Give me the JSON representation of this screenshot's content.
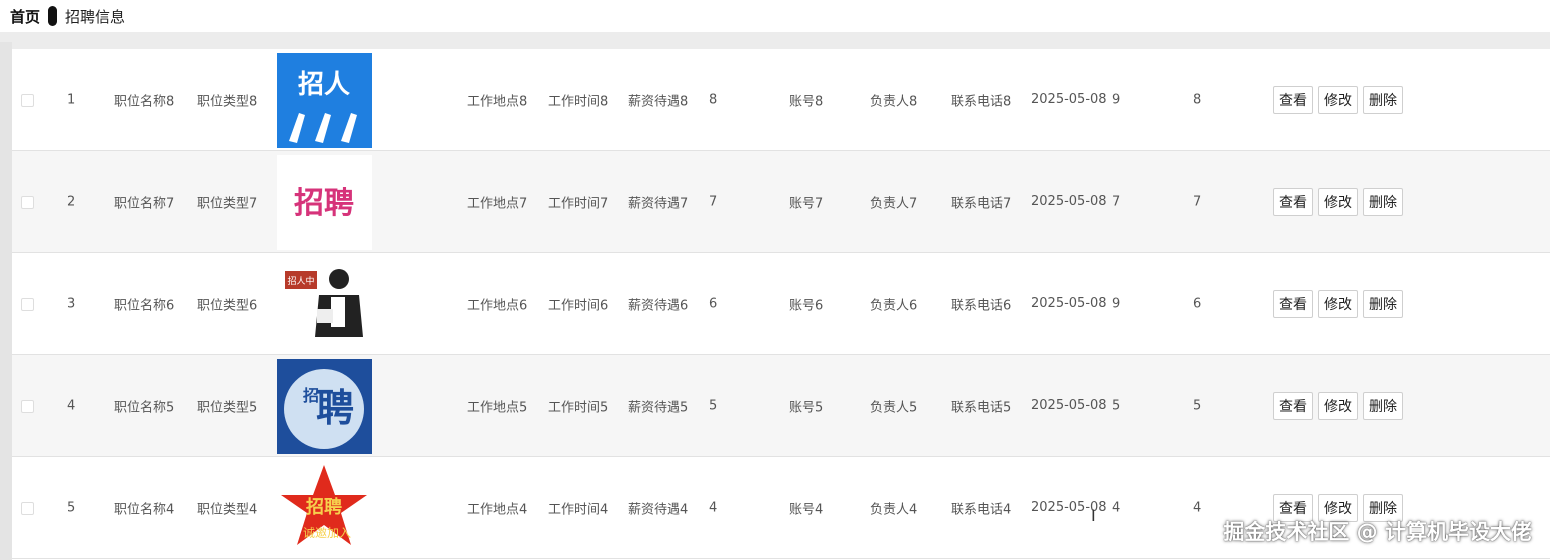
{
  "breadcrumb": {
    "home": "首页",
    "current": "招聘信息"
  },
  "actions": {
    "view": "查看",
    "edit": "修改",
    "delete": "删除"
  },
  "rows": [
    {
      "idx": "1",
      "name": "职位名称8",
      "type": "职位类型8",
      "image": "招人",
      "location": "工作地点8",
      "time": "工作时间8",
      "salary": "薪资待遇8",
      "count": "8",
      "account": "账号8",
      "contact": "负责人8",
      "phone": "联系电话8",
      "date": "2025-05-08",
      "c1": "9",
      "c2": "8"
    },
    {
      "idx": "2",
      "name": "职位名称7",
      "type": "职位类型7",
      "image": "招聘",
      "location": "工作地点7",
      "time": "工作时间7",
      "salary": "薪资待遇7",
      "count": "7",
      "account": "账号7",
      "contact": "负责人7",
      "phone": "联系电话7",
      "date": "2025-05-08",
      "c1": "7",
      "c2": "7"
    },
    {
      "idx": "3",
      "name": "职位名称6",
      "type": "职位类型6",
      "image": "招人中",
      "location": "工作地点6",
      "time": "工作时间6",
      "salary": "薪资待遇6",
      "count": "6",
      "account": "账号6",
      "contact": "负责人6",
      "phone": "联系电话6",
      "date": "2025-05-08",
      "c1": "9",
      "c2": "6"
    },
    {
      "idx": "4",
      "name": "职位名称5",
      "type": "职位类型5",
      "image": "招聘",
      "location": "工作地点5",
      "time": "工作时间5",
      "salary": "薪资待遇5",
      "count": "5",
      "account": "账号5",
      "contact": "负责人5",
      "phone": "联系电话5",
      "date": "2025-05-08",
      "c1": "5",
      "c2": "5"
    },
    {
      "idx": "5",
      "name": "职位名称4",
      "type": "职位类型4",
      "image": "招聘诚邀加入",
      "location": "工作地点4",
      "time": "工作时间4",
      "salary": "薪资待遇4",
      "count": "4",
      "account": "账号4",
      "contact": "负责人4",
      "phone": "联系电话4",
      "date": "2025-05-08",
      "c1": "4",
      "c2": "4"
    }
  ],
  "watermark": "掘金技术社区 @ 计算机毕设大佬"
}
